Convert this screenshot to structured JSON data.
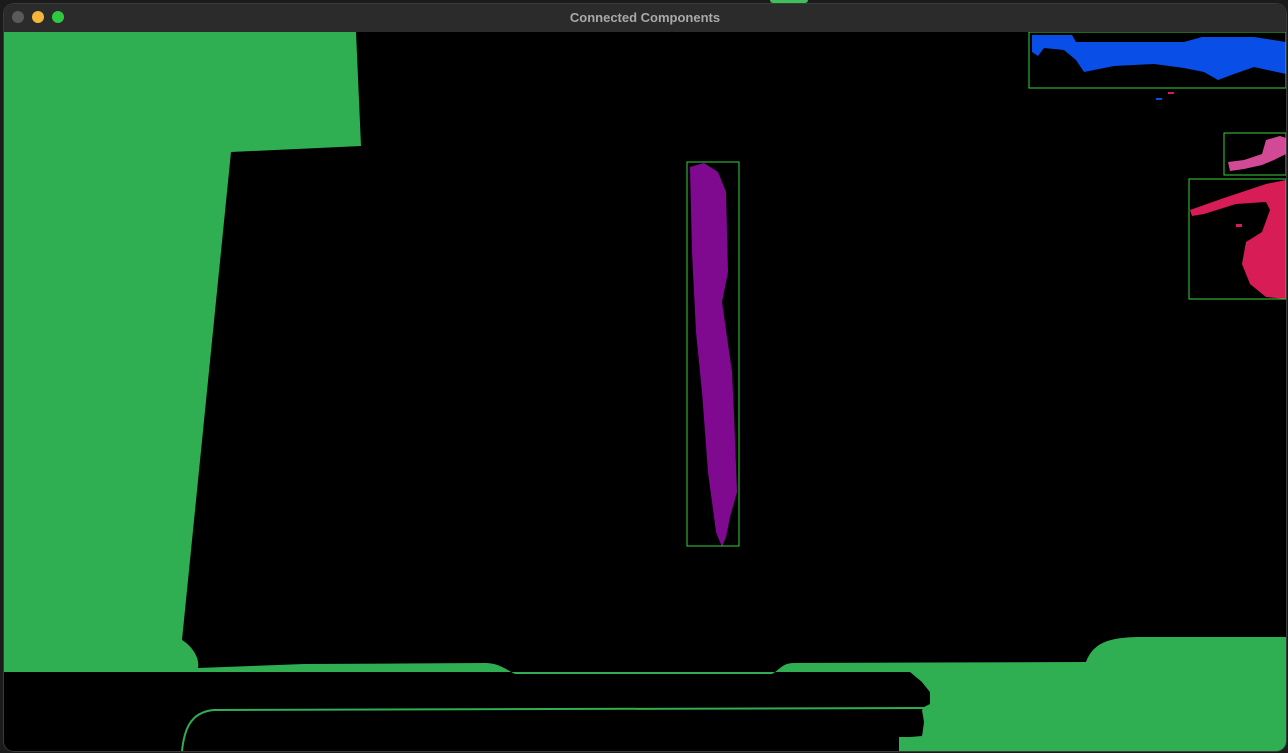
{
  "window": {
    "title": "Connected Components"
  },
  "colors": {
    "background": "#000000",
    "green_region": "#2fae52",
    "purple_component": "#7f0a8f",
    "blue_component": "#0a4ee8",
    "pink_component": "#d24a95",
    "red_component": "#d81c55",
    "bounding_box": "#38d03a",
    "close": "#5a5a5a",
    "minimize": "#f6b43a",
    "maximize": "#2fc840"
  },
  "icons": {
    "close": "close-icon",
    "minimize": "minimize-icon",
    "maximize": "maximize-icon"
  }
}
